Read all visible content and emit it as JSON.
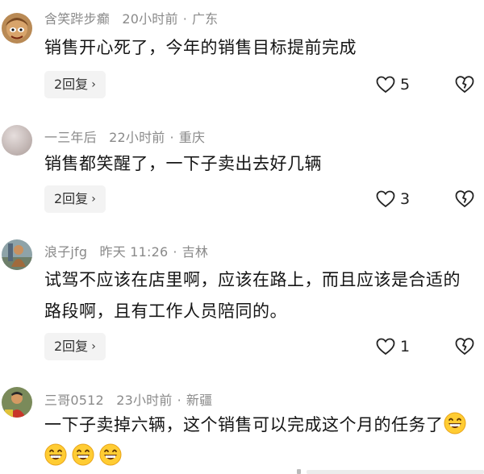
{
  "comments": [
    {
      "username": "含笑跸步癫",
      "time": "20小时前",
      "location": "广东",
      "text": "销售开心死了，今年的销售目标提前完成",
      "reply_label": "2回复",
      "likes": "5"
    },
    {
      "username": "一三年后",
      "time": "22小时前",
      "location": "重庆",
      "text": "销售都笑醒了，一下子卖出去好几辆",
      "reply_label": "2回复",
      "likes": "3"
    },
    {
      "username": "浪子jfg",
      "time": "昨天 11:26",
      "location": "吉林",
      "text": "试驾不应该在店里啊，应该在路上，而且应该是合适的路段啊，且有工作人员陪同的。",
      "reply_label": "2回复",
      "likes": "1"
    },
    {
      "username": "三哥0512",
      "time": "23小时前",
      "location": "新疆",
      "text": "一下子卖掉六辆，这个销售可以完成这个月的任务了",
      "emoji_count": 4
    }
  ],
  "icons": {
    "reply_chevron": "chevron-right-icon",
    "like": "heart-icon",
    "dislike": "broken-heart-icon",
    "emoji": "grinning-face-icon"
  },
  "separator": "·",
  "chevron": "›"
}
